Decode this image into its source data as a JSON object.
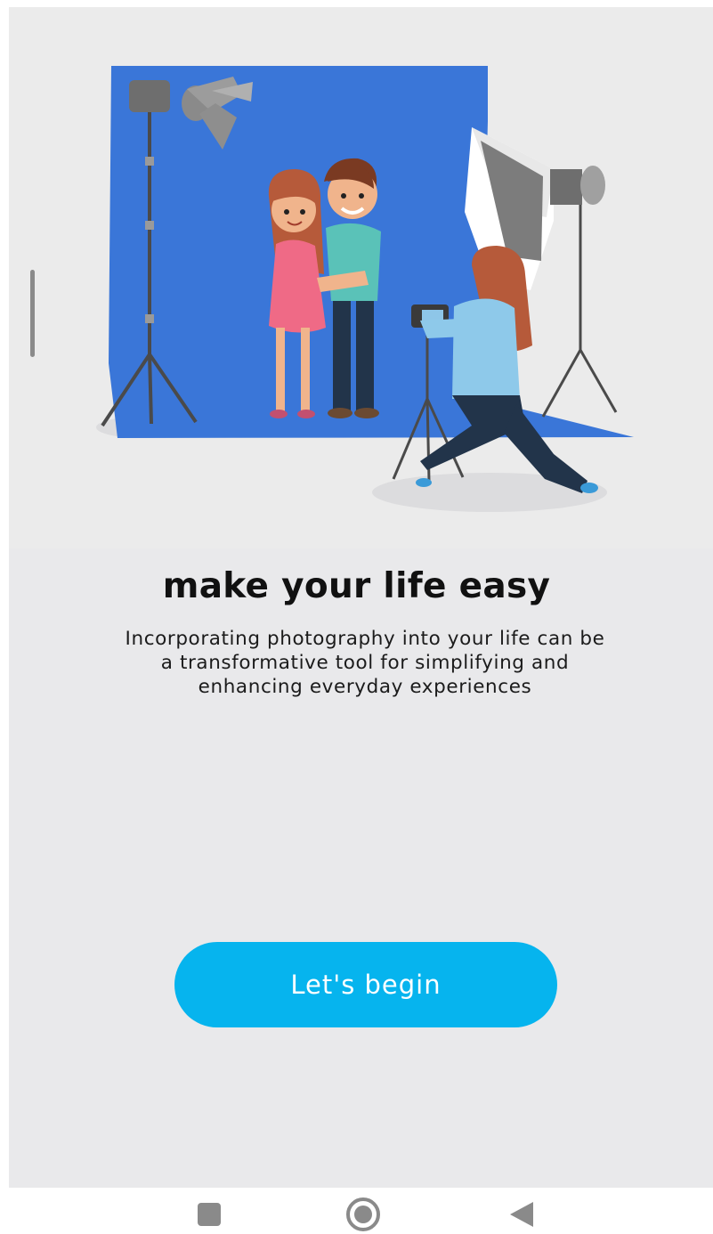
{
  "onboarding": {
    "title": "make your life easy",
    "description": "Incorporating photography into your life can be a transformative tool for simplifying and enhancing everyday experiences",
    "begin_button_label": "Let's begin",
    "illustration_icon": "photo-studio-illustration"
  },
  "navbar": {
    "recents_icon": "square-icon",
    "home_icon": "circle-icon",
    "back_icon": "triangle-back-icon"
  },
  "colors": {
    "background": "#e9e9eb",
    "button": "#06b4ee",
    "backdrop": "#3a76d8",
    "title_text": "#111111"
  }
}
